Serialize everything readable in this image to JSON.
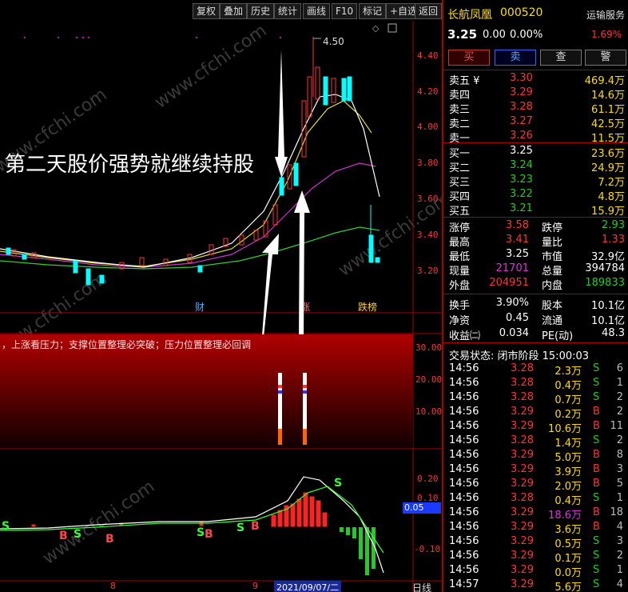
{
  "toolbar": {
    "buttons": [
      "复权",
      "叠加",
      "历史",
      "统计",
      "画线",
      "F10",
      "标记",
      "+自选",
      "返回"
    ]
  },
  "main_chart": {
    "high_label": "4.50",
    "y_ticks": [
      "4.40",
      "4.20",
      "4.00",
      "3.80",
      "3.60",
      "3.40",
      "3.20"
    ],
    "annotation": "第二天股价强势就继续持股",
    "markers": [
      "财",
      "涨",
      "跌榜"
    ]
  },
  "indicator_panel": {
    "text": "，上涨看压力；支撑位置整理必突破；压力位置整理必回调",
    "y_ticks": [
      "30.00",
      "20.00",
      "10.00"
    ]
  },
  "macd_panel": {
    "y_ticks": [
      "0.20",
      "0.10",
      "0.05",
      "-0.10"
    ],
    "current_value": "0.05"
  },
  "bottom_bar": {
    "date_label": "2021/09/07/二",
    "period_label": "日线",
    "left_marks": [
      "8",
      "9"
    ]
  },
  "quote": {
    "name": "长航凤凰",
    "code": "000520",
    "service": "运输服务",
    "price": "3.25",
    "change": "0.00",
    "change_pct": "0.00%",
    "pct_badge": "1.69%",
    "actions": [
      "买",
      "卖",
      "查",
      "警"
    ]
  },
  "asks": [
    {
      "label": "卖五 ¥",
      "price": "3.30",
      "vol": "469.4万"
    },
    {
      "label": "卖四",
      "price": "3.29",
      "vol": "14.6万"
    },
    {
      "label": "卖三",
      "price": "3.28",
      "vol": "61.1万"
    },
    {
      "label": "卖二",
      "price": "3.27",
      "vol": "42.5万"
    },
    {
      "label": "卖一",
      "price": "3.26",
      "vol": "11.5万"
    }
  ],
  "bids": [
    {
      "label": "买一",
      "price": "3.25",
      "vol": "23.6万"
    },
    {
      "label": "买二",
      "price": "3.24",
      "vol": "24.9万"
    },
    {
      "label": "买三",
      "price": "3.23",
      "vol": "7.2万"
    },
    {
      "label": "买四",
      "price": "3.22",
      "vol": "4.8万"
    },
    {
      "label": "买五",
      "price": "3.21",
      "vol": "15.9万"
    }
  ],
  "stats": [
    {
      "l1": "涨停",
      "v1": "3.58",
      "l2": "跌停",
      "v2": "2.93"
    },
    {
      "l1": "最高",
      "v1": "3.41",
      "l2": "量比",
      "v2": "1.33"
    },
    {
      "l1": "最低",
      "v1": "3.25",
      "l2": "市值",
      "v2": "32.9亿"
    },
    {
      "l1": "现量",
      "v1": "21701",
      "l2": "总量",
      "v2": "394784"
    },
    {
      "l1": "外盘",
      "v1": "204951",
      "l2": "内盘",
      "v2": "189833"
    }
  ],
  "stats2": [
    {
      "l1": "换手",
      "v1": "3.90%",
      "l2": "股本",
      "v2": "10.1亿"
    },
    {
      "l1": "净资",
      "v1": "0.45",
      "l2": "流通",
      "v2": "10.1亿"
    },
    {
      "l1": "收益㈡",
      "v1": "0.034",
      "l2": "PE(动)",
      "v2": "48.3"
    }
  ],
  "trade_status": "交易状态: 闭市阶段 15:00:03",
  "trades": [
    {
      "t": "14:56",
      "p": "3.28",
      "v": "2.3万",
      "s": "S",
      "n": "6"
    },
    {
      "t": "14:56",
      "p": "3.28",
      "v": "0.4万",
      "s": "S",
      "n": "1"
    },
    {
      "t": "14:56",
      "p": "3.28",
      "v": "0.7万",
      "s": "S",
      "n": "2"
    },
    {
      "t": "14:56",
      "p": "3.29",
      "v": "0.2万",
      "s": "B",
      "n": "2"
    },
    {
      "t": "14:56",
      "p": "3.29",
      "v": "10.6万",
      "s": "B",
      "n": "11"
    },
    {
      "t": "14:56",
      "p": "3.28",
      "v": "1.4万",
      "s": "S",
      "n": "2"
    },
    {
      "t": "14:56",
      "p": "3.29",
      "v": "5.0万",
      "s": "B",
      "n": "8"
    },
    {
      "t": "14:56",
      "p": "3.29",
      "v": "3.9万",
      "s": "B",
      "n": "3"
    },
    {
      "t": "14:56",
      "p": "3.29",
      "v": "2.0万",
      "s": "B",
      "n": "5"
    },
    {
      "t": "14:56",
      "p": "3.28",
      "v": "0.4万",
      "s": "S",
      "n": "1"
    },
    {
      "t": "14:56",
      "p": "3.29",
      "v": "18.6万",
      "s": "B",
      "n": "18"
    },
    {
      "t": "14:56",
      "p": "3.29",
      "v": "3.6万",
      "s": "B",
      "n": "4"
    },
    {
      "t": "14:56",
      "p": "3.29",
      "v": "0.5万",
      "s": "S",
      "n": "3"
    },
    {
      "t": "14:56",
      "p": "3.29",
      "v": "0.1万",
      "s": "S",
      "n": "2"
    },
    {
      "t": "14:56",
      "p": "3.29",
      "v": "0.0万",
      "s": "S",
      "n": "1"
    },
    {
      "t": "14:57",
      "p": "3.29",
      "v": "5.6万",
      "s": "S",
      "n": "4"
    }
  ],
  "watermark": "www.cfchi.com"
}
